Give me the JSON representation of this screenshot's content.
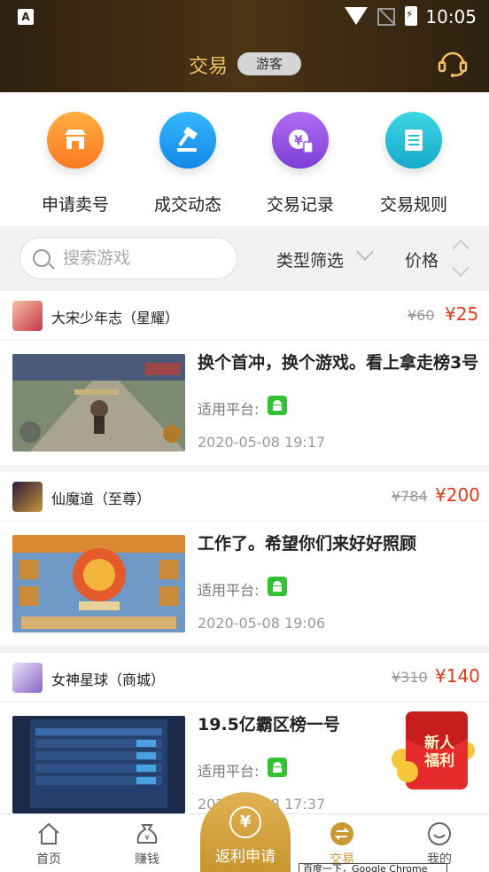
{
  "status_bar": {
    "time": "10:05",
    "notification_icon": "A"
  },
  "header": {
    "title": "交易",
    "badge": "游客",
    "support_icon": "headset-icon"
  },
  "actions": [
    {
      "label": "申请卖号",
      "icon": "shop-icon",
      "color": "#ff8a2a"
    },
    {
      "label": "成交动态",
      "icon": "gavel-icon",
      "color": "#1aa0f0"
    },
    {
      "label": "交易记录",
      "icon": "yen-record-icon",
      "color": "#9a55e6"
    },
    {
      "label": "交易规则",
      "icon": "rules-doc-icon",
      "color": "#22bfd6"
    }
  ],
  "filter": {
    "search_placeholder": "搜索游戏",
    "type_filter": "类型筛选",
    "price_sort": "价格"
  },
  "listings": [
    {
      "game": "大宋少年志（星耀）",
      "old_price": "¥60",
      "price": "¥25",
      "title": "换个首冲，换个游戏。看上拿走榜3号",
      "platform_label": "适用平台:",
      "date": "2020-05-08 19:17"
    },
    {
      "game": "仙魔道（至尊）",
      "old_price": "¥784",
      "price": "¥200",
      "title": "工作了。希望你们来好好照顾",
      "platform_label": "适用平台:",
      "date": "2020-05-08 19:06"
    },
    {
      "game": "女神星球（商城）",
      "old_price": "¥310",
      "price": "¥140",
      "title": "19.5亿霸区榜一号",
      "platform_label": "适用平台:",
      "date": "2020-05-08 17:37"
    }
  ],
  "red_packet": {
    "text_line1": "新人",
    "text_line2": "福利"
  },
  "bottom_nav": {
    "items": [
      {
        "label": "首页",
        "icon": "home-icon"
      },
      {
        "label": "赚钱",
        "icon": "money-bag-icon"
      },
      {
        "label": "交易",
        "icon": "exchange-icon",
        "active": true
      },
      {
        "label": "我的",
        "icon": "smile-icon"
      }
    ],
    "center_button": {
      "label": "返利申请",
      "icon": "yen-coin-icon"
    }
  },
  "tooltip": "百度一下，Google Chrome",
  "colors": {
    "accent_gold": "#c99a33",
    "price_red": "#e03a1c",
    "header_dark": "#2e2110",
    "android_green": "#35c134"
  }
}
